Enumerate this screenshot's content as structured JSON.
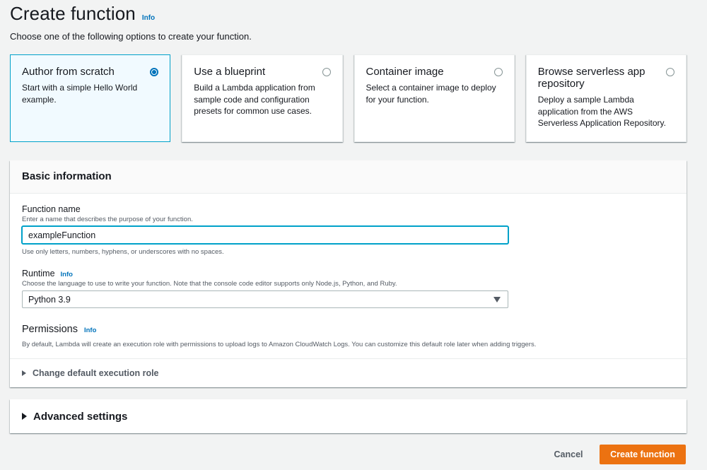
{
  "header": {
    "title": "Create function",
    "info_label": "Info",
    "subtitle": "Choose one of the following options to create your function."
  },
  "options": [
    {
      "title": "Author from scratch",
      "description": "Start with a simple Hello World example.",
      "selected": true
    },
    {
      "title": "Use a blueprint",
      "description": "Build a Lambda application from sample code and configuration presets for common use cases.",
      "selected": false
    },
    {
      "title": "Container image",
      "description": "Select a container image to deploy for your function.",
      "selected": false
    },
    {
      "title": "Browse serverless app repository",
      "description": "Deploy a sample Lambda application from the AWS Serverless Application Repository.",
      "selected": false
    }
  ],
  "basic_info": {
    "title": "Basic information",
    "function_name": {
      "label": "Function name",
      "description": "Enter a name that describes the purpose of your function.",
      "value": "exampleFunction",
      "constraint": "Use only letters, numbers, hyphens, or underscores with no spaces."
    },
    "runtime": {
      "label": "Runtime",
      "info_label": "Info",
      "description": "Choose the language to use to write your function. Note that the console code editor supports only Node.js, Python, and Ruby.",
      "value": "Python 3.9"
    },
    "permissions": {
      "label": "Permissions",
      "info_label": "Info",
      "description": "By default, Lambda will create an execution role with permissions to upload logs to Amazon CloudWatch Logs. You can customize this default role later when adding triggers.",
      "expander_label": "Change default execution role"
    }
  },
  "advanced": {
    "label": "Advanced settings"
  },
  "footer": {
    "cancel_label": "Cancel",
    "create_label": "Create function"
  },
  "colors": {
    "accent": "#0073bb",
    "primary_button": "#ec7211",
    "selected_border": "#00a1c9",
    "selected_bg": "#f1faff"
  }
}
